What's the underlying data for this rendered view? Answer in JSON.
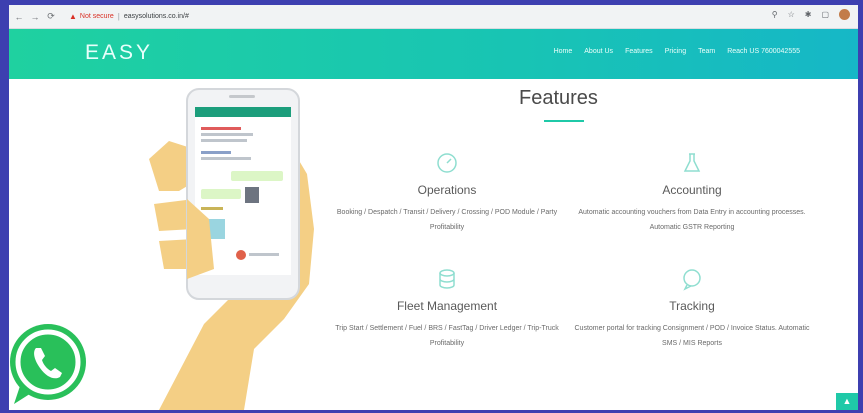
{
  "browser": {
    "not_secure": "Not secure",
    "url": "easysolutions.co.in/#"
  },
  "site": {
    "logo": "EASY",
    "nav": [
      "Home",
      "About Us",
      "Features",
      "Pricing",
      "Team",
      "Reach US 7600042555"
    ]
  },
  "section": {
    "title": "Features"
  },
  "features": [
    {
      "name": "Operations",
      "desc": "Booking / Despatch / Transit / Delivery / Crossing / POD Module / Party Profitability",
      "icon": "gauge-icon"
    },
    {
      "name": "Accounting",
      "desc": "Automatic accounting vouchers from Data Entry in accounting processes. Automatic GSTR Reporting",
      "icon": "flask-icon"
    },
    {
      "name": "Fleet Management",
      "desc": "Trip Start / Settlement / Fuel / BRS / FastTag / Driver Ledger / Trip-Truck Profitability",
      "icon": "database-icon"
    },
    {
      "name": "Tracking",
      "desc": "Customer portal for tracking Consignment / POD / Invoice Status. Automatic SMS / MIS Reports",
      "icon": "chat-icon"
    }
  ],
  "colors": {
    "accent": "#1fc9a8",
    "page_bg": "#3d3fb0"
  }
}
